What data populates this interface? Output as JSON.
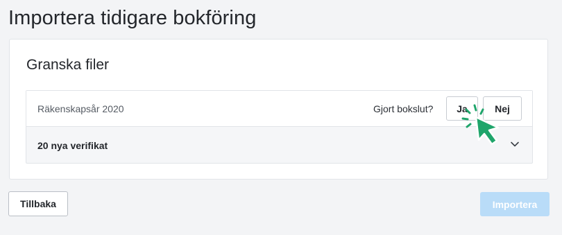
{
  "page": {
    "title": "Importera tidigare bokföring"
  },
  "card": {
    "title": "Granska filer",
    "file": {
      "fiscal_year": "Räkenskapsår 2020",
      "question": "Gjort bokslut?",
      "yes_label": "Ja",
      "no_label": "Nej",
      "section_label": "20 nya verifikat",
      "section_icon": "chevron-down-icon"
    }
  },
  "footer": {
    "back_label": "Tillbaka",
    "import_label": "Importera"
  },
  "colors": {
    "background": "#f3f4f6",
    "import_disabled": "#b9dcf8",
    "cursor_accent": "#1fa56b"
  },
  "cursor": {
    "icon": "click-cursor-icon"
  }
}
